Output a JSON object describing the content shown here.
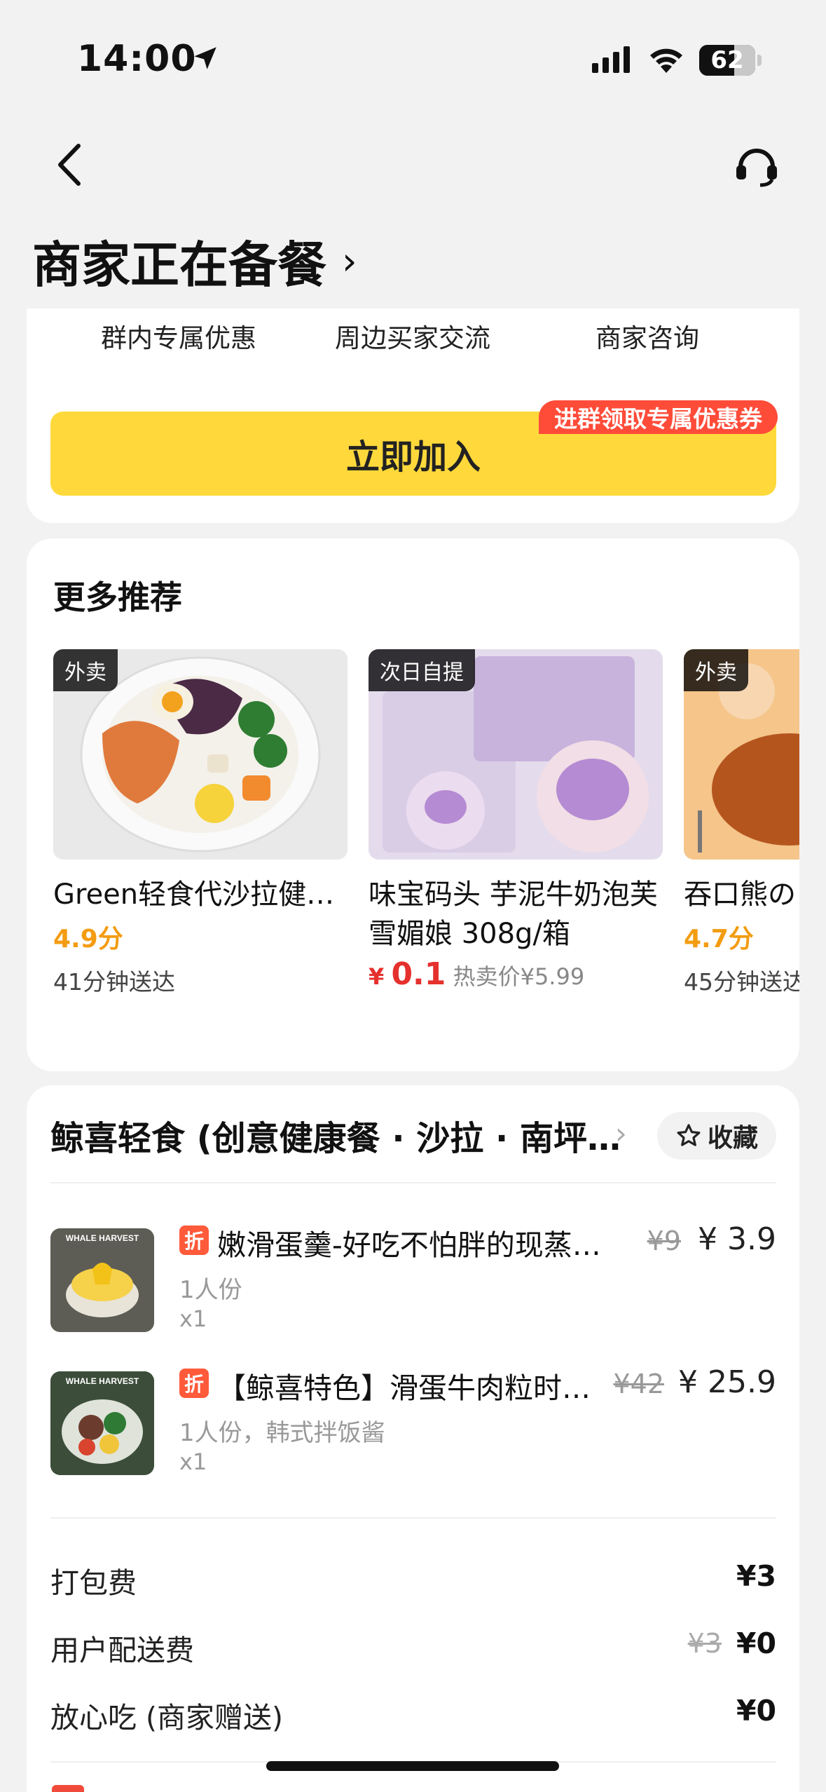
{
  "status_bar": {
    "time": "14:00",
    "battery": "62"
  },
  "header": {
    "title": "商家正在备餐",
    "title_chevron": "›"
  },
  "group_card": {
    "features": [
      "群内专属优惠",
      "周边买家交流",
      "商家咨询"
    ],
    "join_button": "立即加入",
    "join_badge": "进群领取专属优惠券"
  },
  "recommendations": {
    "title": "更多推荐",
    "items": [
      {
        "tag": "外卖",
        "name": "Green轻食代沙拉健…",
        "score": "4.9分",
        "eta": "41分钟送达"
      },
      {
        "tag": "次日自提",
        "name": "味宝码头 芋泥牛奶泡芙雪媚娘 308g/箱",
        "price_symbol": "¥",
        "price": "0.1",
        "hot_label": "热卖价",
        "hot_price": "¥5.99"
      },
      {
        "tag": "外卖",
        "name": "吞口熊の",
        "score": "4.7分",
        "eta": "45分钟送达"
      }
    ]
  },
  "order": {
    "store_name": "鲸喜轻食 (创意健康餐 · 沙拉 · 南坪…",
    "store_chevron": "›",
    "favorite_label": "收藏",
    "items": [
      {
        "discount_badge": "折",
        "name": "嫩滑蛋羹-好吃不怕胖的现蒸…",
        "original_price": "¥9",
        "price": "¥ 3.9",
        "spec": "1人份",
        "qty": "x1",
        "img_text": "WHALE HARVEST"
      },
      {
        "discount_badge": "折",
        "name": "【鲸喜特色】滑蛋牛肉粒时…",
        "original_price": "¥42",
        "price": "¥ 25.9",
        "spec": "1人份，韩式拌饭酱",
        "qty": "x1",
        "img_text": "WHALE HARVEST"
      }
    ],
    "fees": [
      {
        "label": "打包费",
        "value": "¥3",
        "original": ""
      },
      {
        "label": "用户配送费",
        "value": "¥0",
        "original": "¥3"
      },
      {
        "label": "放心吃 (商家赠送)",
        "value": "¥0",
        "original": ""
      }
    ]
  },
  "colors": {
    "accent_yellow": "#ffd93b",
    "badge_red": "#ff4c39",
    "score_orange": "#f39c12",
    "price_red": "#e5312e"
  }
}
